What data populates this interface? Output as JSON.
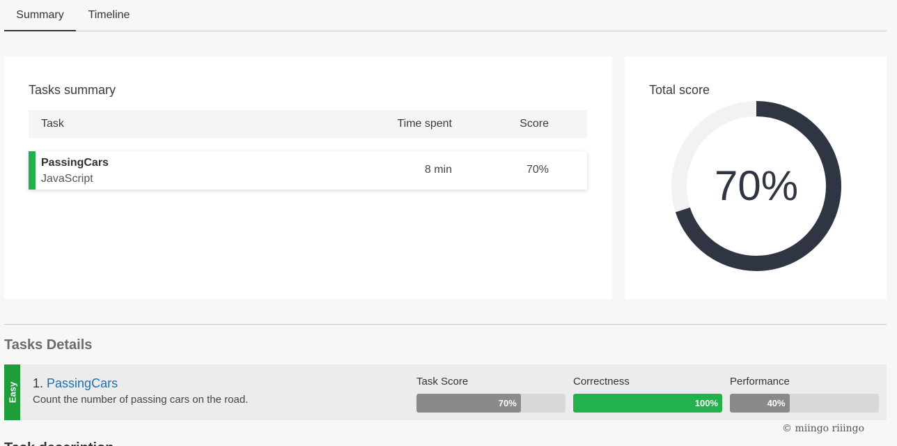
{
  "tabs": [
    {
      "label": "Summary",
      "active": true
    },
    {
      "label": "Timeline",
      "active": false
    }
  ],
  "tasks_summary": {
    "title": "Tasks summary",
    "columns": {
      "task": "Task",
      "time": "Time spent",
      "score": "Score"
    },
    "rows": [
      {
        "name": "PassingCars",
        "language": "JavaScript",
        "time": "8 min",
        "score": "70%",
        "status_color": "#22b14c"
      }
    ]
  },
  "total_score": {
    "title": "Total score",
    "label": "70%",
    "fraction": 0.7,
    "ring_color": "#2f3542",
    "track_color": "#f2f2f2"
  },
  "tasks_details": {
    "title": "Tasks Details",
    "items": [
      {
        "difficulty": "Easy",
        "number": "1.",
        "name": "PassingCars",
        "description": "Count the number of passing cars on the road.",
        "metrics": [
          {
            "label": "Task Score",
            "value_text": "70%",
            "fraction": 0.7,
            "color": "#8a8a8a"
          },
          {
            "label": "Correctness",
            "value_text": "100%",
            "fraction": 1.0,
            "color": "#22b14c"
          },
          {
            "label": "Performance",
            "value_text": "40%",
            "fraction": 0.4,
            "color": "#8a8a8a"
          }
        ]
      }
    ]
  },
  "watermark": "© miingo riiingo",
  "next_section_title": "Task description"
}
